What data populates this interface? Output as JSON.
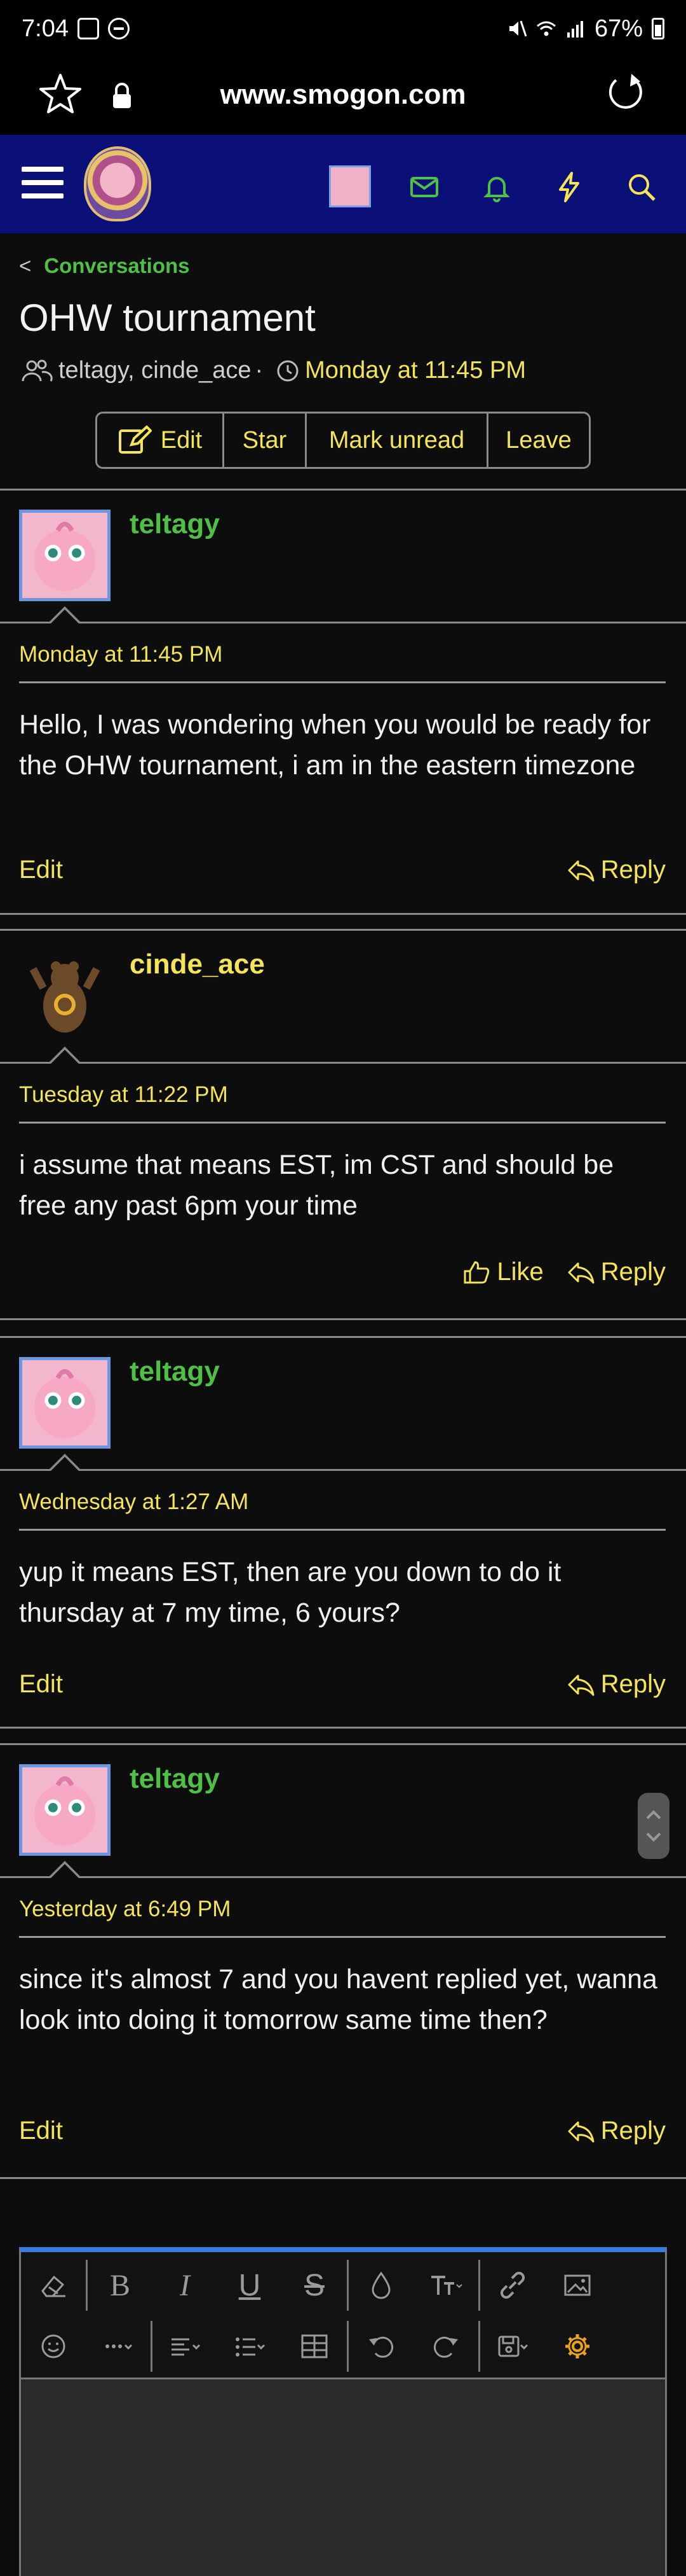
{
  "status_bar": {
    "time": "7:04",
    "battery": "67%"
  },
  "browser": {
    "url": "www.smogon.com"
  },
  "breadcrumb": {
    "label": "Conversations"
  },
  "conversation": {
    "title": "OHW tournament",
    "participants": "teltagy, cinde_ace",
    "separator": "·",
    "date": "Monday at 11:45 PM",
    "actions": {
      "edit": "Edit",
      "star": "Star",
      "mark_unread": "Mark unread",
      "leave": "Leave"
    }
  },
  "messages": [
    {
      "author": "teltagy",
      "date": "Monday at 11:45 PM",
      "body": "Hello, I was wondering when you would be ready for the OHW tournament, i am in the eastern timezone",
      "left_action": "Edit",
      "reply": "Reply"
    },
    {
      "author": "cinde_ace",
      "date": "Tuesday at 11:22 PM",
      "body": "i assume that means EST, im CST and should be free any past 6pm your time",
      "like": "Like",
      "reply": "Reply"
    },
    {
      "author": "teltagy",
      "date": "Wednesday at 1:27 AM",
      "body": "yup it means EST, then are you down to do it thursday at 7 my time, 6 yours?",
      "left_action": "Edit",
      "reply": "Reply"
    },
    {
      "author": "teltagy",
      "date": "Yesterday at 6:49 PM",
      "body": "since it's almost 7 and you havent replied yet, wanna look into doing it tomorrow same time then?",
      "left_action": "Edit",
      "reply": "Reply"
    }
  ],
  "editor": {
    "bold": "B",
    "italic": "I",
    "underline": "U",
    "strike": "S"
  },
  "colors": {
    "header_bg": "#0b1078",
    "accent_yellow": "#f3e45a",
    "accent_green": "#4fbf46",
    "editor_accent": "#3a7ad8"
  }
}
